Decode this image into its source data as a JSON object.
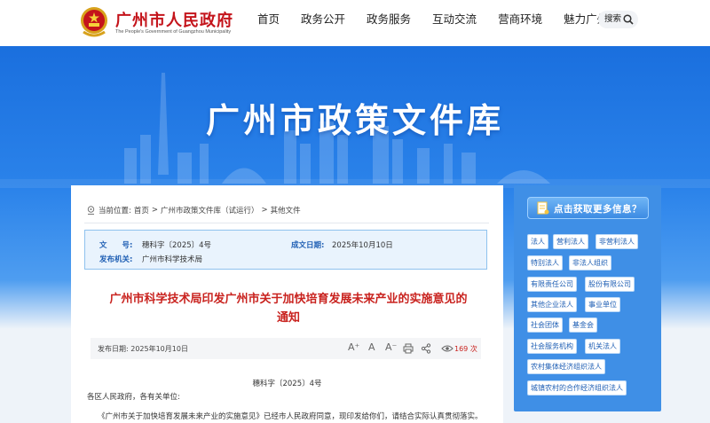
{
  "header": {
    "site_title": "广州市人民政府",
    "site_subtitle": "The People's Government of Guangzhou Municipality",
    "nav": [
      "首页",
      "政务公开",
      "政务服务",
      "互动交流",
      "营商环境",
      "魅力广州"
    ],
    "search_label": "搜索"
  },
  "banner": {
    "title": "广州市政策文件库"
  },
  "breadcrumb": {
    "prefix": "当前位置:",
    "items": [
      "首页",
      ">",
      "广州市政策文件库（试运行）",
      ">",
      "其他文件"
    ]
  },
  "doc_info": {
    "num_label": "文　　号:",
    "num_value": "穗科字〔2025〕4号",
    "date_label": "成文日期:",
    "date_value": "2025年10月10日",
    "org_label": "发布机关:",
    "org_value": "广州市科学技术局"
  },
  "doc": {
    "title": "广州市科学技术局印发广州市关于加快培育发展未来产业的实施意见的通知",
    "publish_date": "发布日期: 2025年10月10日",
    "views": "169",
    "views_unit": "次",
    "number_line": "穗科字〔2025〕4号",
    "salutation": "各区人民政府，各有关单位:",
    "body_line": "《广州市关于加快培育发展未来产业的实施意见》已经市人民政府同意，现印发给你们，请结合实际认真贯彻落实。"
  },
  "tools": {
    "font_up": "A⁺",
    "font_normal": "A",
    "font_down": "A⁻"
  },
  "side": {
    "header": "点击获取更多信息？",
    "tags": [
      "法人",
      "营利法人",
      "非营利法人",
      "特别法人",
      "非法人组织",
      "有限责任公司",
      "股份有限公司",
      "其他企业法人",
      "事业单位",
      "社会团体",
      "基金会",
      "社会服务机构",
      "机关法人",
      "农村集体经济组织法人",
      "城镇农村的合作经济组织法人"
    ]
  },
  "colors": {
    "brand_red": "#c4141b",
    "banner_blue": "#1a6fde",
    "panel_blue": "#3f8fe6"
  }
}
